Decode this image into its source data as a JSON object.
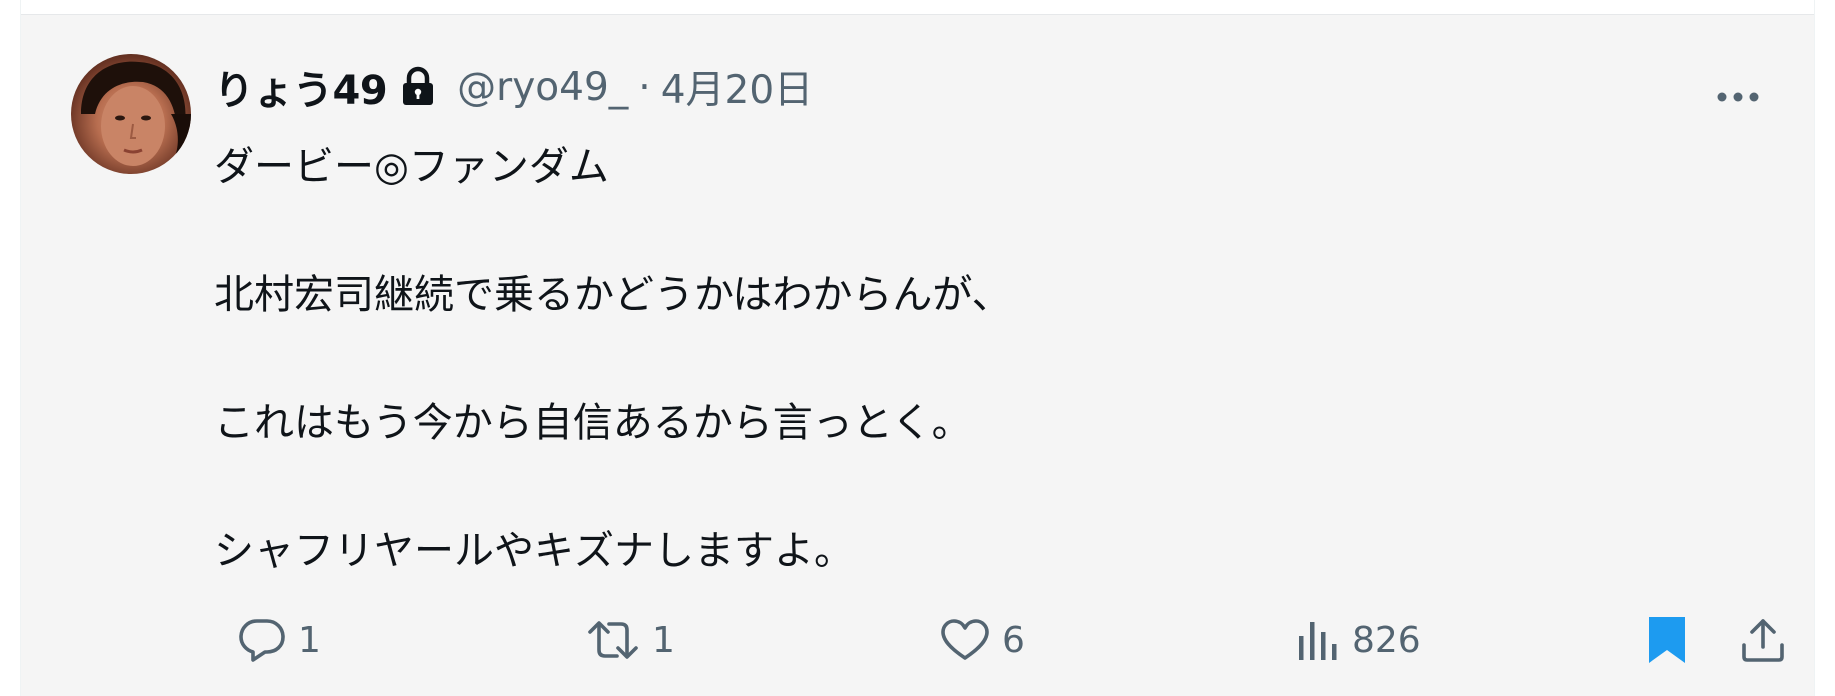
{
  "tweet": {
    "author": {
      "display_name": "りょう49",
      "handle": "@ryo49_",
      "protected_icon": "lock-icon",
      "avatar": "user-avatar-photo"
    },
    "separator": "·",
    "date": "4月20日",
    "text_lines": [
      "ダービー◎ファンダム",
      "北村宏司継続で乗るかどうかはわからんが、",
      "これはもう今から自信あるから言っとく。",
      "シャフリヤールやキズナしますよ。"
    ],
    "actions": {
      "reply": {
        "icon": "reply-icon",
        "count": "1"
      },
      "retweet": {
        "icon": "retweet-icon",
        "count": "1"
      },
      "like": {
        "icon": "like-icon",
        "count": "6"
      },
      "views": {
        "icon": "views-icon",
        "count": "826"
      },
      "bookmark": {
        "icon": "bookmark-icon",
        "state": "bookmarked"
      },
      "share": {
        "icon": "share-icon"
      }
    },
    "more_icon": "more-options-icon"
  },
  "colors": {
    "text_primary": "#0f1419",
    "text_secondary": "#536471",
    "bookmark_active": "#1d9bf0",
    "background": "#f5f5f5"
  }
}
